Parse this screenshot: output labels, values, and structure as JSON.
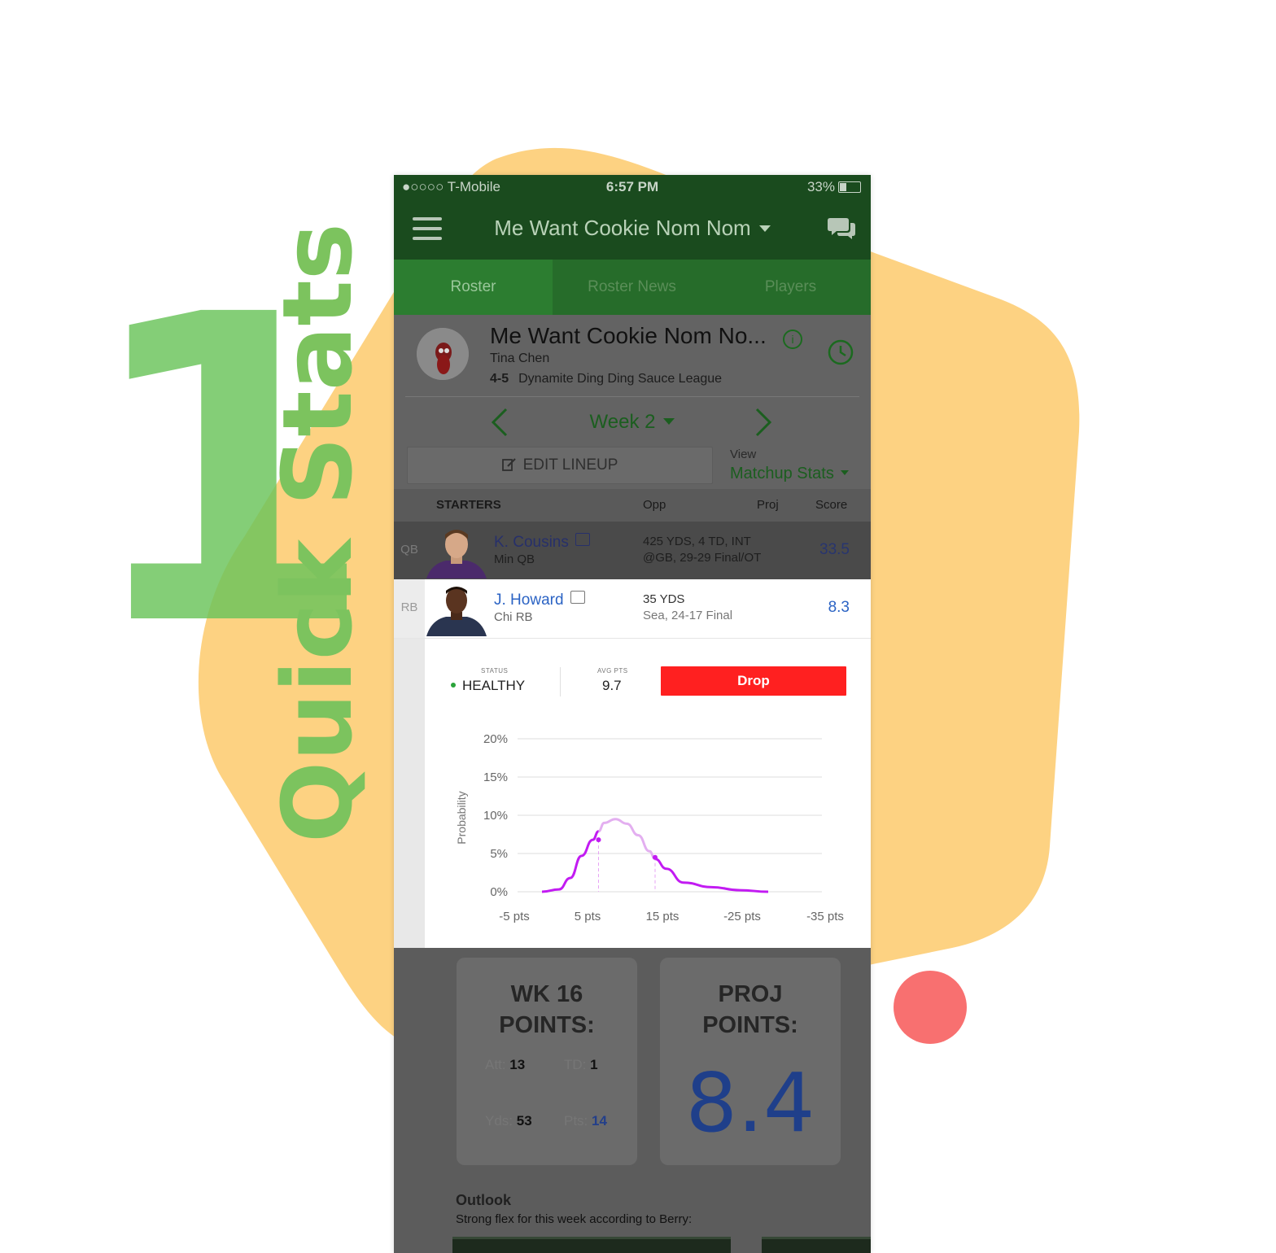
{
  "hero": {
    "number": "1",
    "title": "Quick Stats"
  },
  "colors": {
    "accent_green": "#7cc35e",
    "blob": "#fdd282",
    "dot": "#f87070",
    "drop_red": "#ff2020",
    "curve": "#c21bf2"
  },
  "status_bar": {
    "carrier": "●○○○○ T-Mobile",
    "time": "6:57 PM",
    "battery": "33%"
  },
  "nav": {
    "title": "Me Want Cookie Nom Nom",
    "menu_icon": "hamburger-icon",
    "chat_icon": "chat-icon"
  },
  "tabs": [
    {
      "label": "Roster",
      "active": true
    },
    {
      "label": "Roster News"
    },
    {
      "label": "Players"
    }
  ],
  "team": {
    "name": "Me Want Cookie Nom No...",
    "owner": "Tina Chen",
    "record": "4-5",
    "league": "Dynamite Ding Ding Sauce League"
  },
  "week": {
    "label": "Week 2"
  },
  "lineup": {
    "edit_label": "EDIT LINEUP",
    "view_label": "View",
    "view_value": "Matchup Stats"
  },
  "table_header": {
    "starters": "STARTERS",
    "opp": "Opp",
    "proj": "Proj",
    "score": "Score"
  },
  "players": [
    {
      "slot": "QB",
      "name": "K. Cousins",
      "team": "Min",
      "pos": "QB",
      "stat": "425 YDS, 4 TD, INT",
      "game": "@GB, 29-29 Final/OT",
      "score": "33.5"
    },
    {
      "slot": "RB",
      "name": "J. Howard",
      "team": "Chi",
      "pos": "RB",
      "stat": "35 YDS",
      "game": "Sea, 24-17 Final",
      "score": "8.3"
    }
  ],
  "quick": {
    "status_label": "STATUS",
    "status_value": "HEALTHY",
    "avg_label": "AVG PTS",
    "avg_value": "9.7",
    "drop_label": "Drop"
  },
  "chart_data": {
    "type": "line",
    "title": "",
    "xlabel": "",
    "ylabel": "Probability",
    "x_ticks": [
      "-5 pts",
      "5 pts",
      "15 pts",
      "-25 pts",
      "-35 pts"
    ],
    "y_ticks": [
      "20%",
      "15%",
      "10%",
      "5%",
      "0%"
    ],
    "ylim": [
      0,
      20
    ],
    "xlim": [
      -5,
      35
    ],
    "grid": true,
    "series": [
      {
        "x": [
          -5,
          -2,
          0,
          2,
          4,
          5,
          6,
          8,
          10,
          12,
          14,
          15,
          17,
          20,
          25,
          30,
          35
        ],
        "y": [
          0.0,
          0.3,
          1.8,
          4.7,
          6.8,
          7.9,
          9.0,
          9.5,
          8.9,
          7.4,
          5.3,
          4.3,
          3.0,
          1.2,
          0.6,
          0.2,
          0.0
        ]
      }
    ],
    "markers": [
      {
        "x": 5,
        "y": 6.8
      },
      {
        "x": 15,
        "y": 4.5
      }
    ]
  },
  "stats_cards": {
    "wk": {
      "title_line1": "WK 16",
      "title_line2": "POINTS:",
      "att_label": "Att:",
      "att": "13",
      "td_label": "TD:",
      "td": "1",
      "yds_label": "Yds:",
      "yds": "53",
      "pts_label": "Pts:",
      "pts": "14"
    },
    "proj": {
      "title_line1": "PROJ",
      "title_line2": "POINTS:",
      "value": "8.4"
    }
  },
  "outlook": {
    "title": "Outlook",
    "text": "Strong flex for this week according to Berry:"
  }
}
